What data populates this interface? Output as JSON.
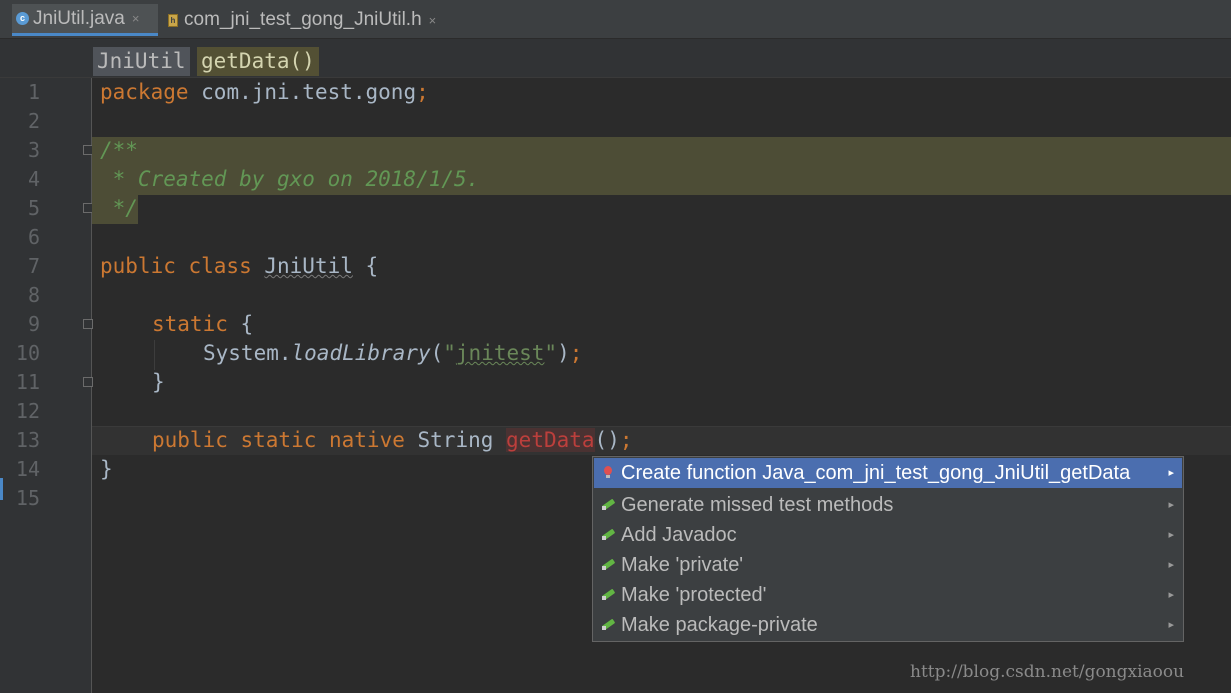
{
  "tabs": [
    {
      "label": "JniUtil.java",
      "icon": "java-class-icon",
      "close": "×",
      "active": true
    },
    {
      "label": "com_jni_test_gong_JniUtil.h",
      "icon": "header-file-icon",
      "close": "×",
      "active": false
    }
  ],
  "breadcrumb": [
    "JniUtil",
    "getData()"
  ],
  "line_numbers": [
    "1",
    "2",
    "3",
    "4",
    "5",
    "6",
    "7",
    "8",
    "9",
    "10",
    "11",
    "12",
    "13",
    "14",
    "15"
  ],
  "code": {
    "l1_kw": "package",
    "l1_rest": " com.jni.test.gong",
    "l1_semi": ";",
    "l3": "/**",
    "l4": " * Created by gxo on 2018/1/5.",
    "l5": " */",
    "l7_kw": "public class ",
    "l7_name": "JniUtil",
    "l7_brace": " {",
    "l9_kw": "static",
    "l9_brace": " {",
    "l10_obj": "System.",
    "l10_method": "loadLibrary",
    "l10_open": "(",
    "l10_str_q1": "\"",
    "l10_str": "jnitest",
    "l10_str_q2": "\"",
    "l10_close": ")",
    "l10_semi": ";",
    "l11": "}",
    "l13_kw": "public static native ",
    "l13_type": "String ",
    "l13_name": "getData",
    "l13_paren": "()",
    "l13_semi": ";",
    "l14": "}"
  },
  "popup": {
    "items": [
      {
        "label": "Create function Java_com_jni_test_gong_JniUtil_getData",
        "icon": "bulb-error-icon",
        "arrow": "▸",
        "selected": true
      },
      {
        "label": "Generate missed test methods",
        "icon": "intention-icon",
        "arrow": "▸",
        "selected": false
      },
      {
        "label": "Add Javadoc",
        "icon": "intention-icon",
        "arrow": "▸",
        "selected": false
      },
      {
        "label": "Make 'private'",
        "icon": "intention-icon",
        "arrow": "▸",
        "selected": false
      },
      {
        "label": "Make 'protected'",
        "icon": "intention-icon",
        "arrow": "▸",
        "selected": false
      },
      {
        "label": "Make package-private",
        "icon": "intention-icon",
        "arrow": "▸",
        "selected": false
      }
    ]
  },
  "watermark": "http://blog.csdn.net/gongxiaoou",
  "colors": {
    "background": "#2b2b2b",
    "keyword": "#cc7832",
    "comment": "#629755",
    "string": "#6a8759",
    "selection": "#4b6eaf",
    "error": "#bc3f3c"
  }
}
